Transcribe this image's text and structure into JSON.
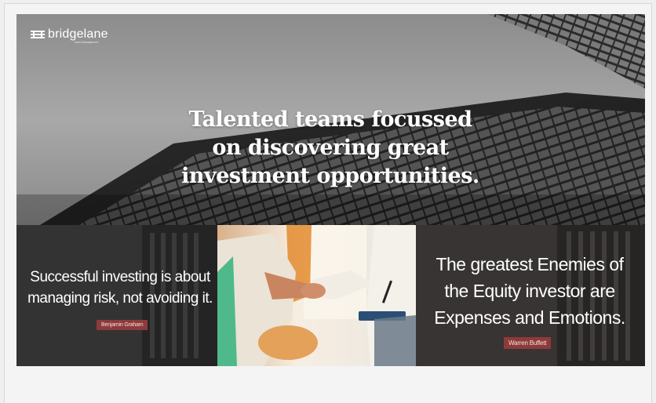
{
  "brand": {
    "name": "bridgelane",
    "tagline": "Asset Management",
    "logo_icon": "bridge-mark-icon"
  },
  "hero": {
    "headline_line1": "Talented teams focussed",
    "headline_line2": "on discovering great",
    "headline_line3": "investment opportunities."
  },
  "quotes": [
    {
      "line1": "Successful investing is about",
      "line2": "managing risk, not avoiding it.",
      "author": "Benjamin Graham"
    },
    {
      "line1": "The greatest Enemies of",
      "line2": "the Equity investor are",
      "line3": "Expenses and Emotions.",
      "author": "Warren Buffett"
    }
  ],
  "middle_image": {
    "description": "handshake-photo"
  },
  "colors": {
    "author_badge": "#8e3a3a",
    "text_light": "#ffffff"
  }
}
